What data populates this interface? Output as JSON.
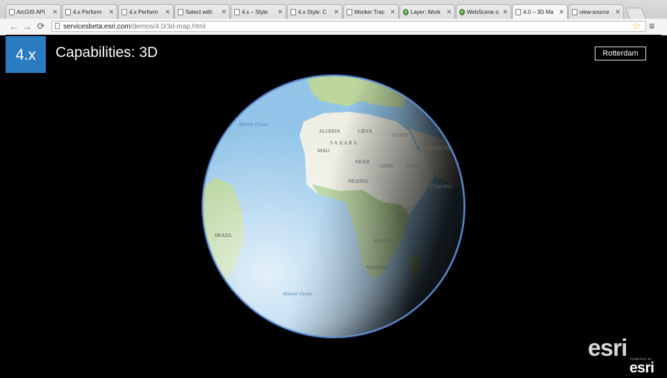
{
  "browser": {
    "tabs": [
      {
        "label": "ArcGIS API",
        "icon": "page-icon",
        "active": false
      },
      {
        "label": "4.x Perform",
        "icon": "page-icon",
        "active": false
      },
      {
        "label": "4.x Perform",
        "icon": "page-icon",
        "active": false
      },
      {
        "label": "Select with",
        "icon": "page-icon",
        "active": false
      },
      {
        "label": "4.x – Style",
        "icon": "page-icon",
        "active": false
      },
      {
        "label": "4.x Style: C",
        "icon": "page-icon",
        "active": false
      },
      {
        "label": "Worker Trac",
        "icon": "page-icon",
        "active": false
      },
      {
        "label": "Layer: Work",
        "icon": "globe-icon",
        "active": false
      },
      {
        "label": "WebScene o",
        "icon": "globe-icon",
        "active": false
      },
      {
        "label": "4.0 – 3D Ma",
        "icon": "page-icon",
        "active": true
      },
      {
        "label": "view-source",
        "icon": "page-icon",
        "active": false
      }
    ],
    "url_host": "servicesbeta.esri.com",
    "url_path": "/demos/4.0/3d-map.html"
  },
  "page": {
    "version_badge": "4.x",
    "title": "Capabilities: 3D",
    "city_button": "Rotterdam"
  },
  "globe": {
    "labels": [
      "Atlantic Ocean",
      "ALGERIA",
      "LIBYA",
      "EGYPT",
      "SAHARA",
      "MALI",
      "NIGER",
      "CHAD",
      "SUDAN",
      "NIGERIA",
      "DEM. REP.",
      "OF THE",
      "CONGO",
      "ANGOLA",
      "NAMIBIA",
      "BRAZIL",
      "Atlantic Ocean",
      "ETHIOPIA",
      "SAUDI ARABIA"
    ],
    "colors": {
      "ocean": "#8fc3e8",
      "land_green": "#a9cc8a",
      "land_desert": "#eeeee4",
      "rim": "#5b86c9"
    }
  },
  "branding": {
    "logo_big": "esri",
    "powered_by": "POWERED BY",
    "logo_small": "esri"
  }
}
